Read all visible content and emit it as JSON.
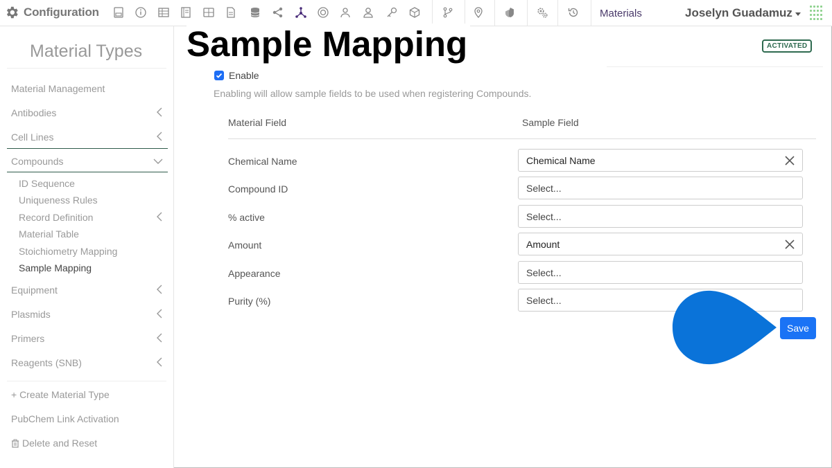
{
  "app": {
    "title": "Configuration",
    "materials_link": "Materials",
    "user_name": "Joselyn Guadamuz",
    "nav_icons": [
      "form-icon",
      "info-icon",
      "table-icon",
      "notebook-icon",
      "grid-icon",
      "document-icon",
      "database-icon",
      "share-icon",
      "molecule-icon",
      "badge-icon",
      "users-icon",
      "user-icon",
      "key-icon",
      "cube-icon",
      "git-branch-icon",
      "location-icon",
      "shield-icon",
      "settings-icon",
      "history-icon"
    ],
    "accent_color": "#1a73f5",
    "status_color": "#2e6a4f"
  },
  "sidebar": {
    "title": "Material Types",
    "management": "Material Management",
    "antibodies": "Antibodies",
    "cell_lines": "Cell Lines",
    "compounds": "Compounds",
    "sub": {
      "id_sequence": "ID Sequence",
      "uniqueness_rules": "Uniqueness Rules",
      "record_definition": "Record Definition",
      "material_table": "Material Table",
      "stoichiometry_mapping": "Stoichiometry Mapping",
      "sample_mapping": "Sample Mapping"
    },
    "equipment": "Equipment",
    "plasmids": "Plasmids",
    "primers": "Primers",
    "reagents": "Reagents (SNB)",
    "create": "+ Create Material Type",
    "pubchem": "PubChem Link Activation",
    "delete_reset": "Delete and Reset"
  },
  "main": {
    "title": "Sample Mapping",
    "status": "ACTIVATED",
    "enable_label": "Enable",
    "enable_checked": true,
    "help_text": "Enabling will allow sample fields to be used when registering Compounds.",
    "col_material": "Material Field",
    "col_sample": "Sample Field",
    "rows": [
      {
        "label": "Chemical Name",
        "value": "Chemical Name",
        "is_set": true
      },
      {
        "label": "Compound ID",
        "value": "Select...",
        "is_set": false
      },
      {
        "label": "% active",
        "value": "Select...",
        "is_set": false
      },
      {
        "label": "Amount",
        "value": "Amount",
        "is_set": true
      },
      {
        "label": "Appearance",
        "value": "Select...",
        "is_set": false
      },
      {
        "label": "Purity (%)",
        "value": "Select...",
        "is_set": false
      }
    ],
    "save_label": "Save"
  }
}
